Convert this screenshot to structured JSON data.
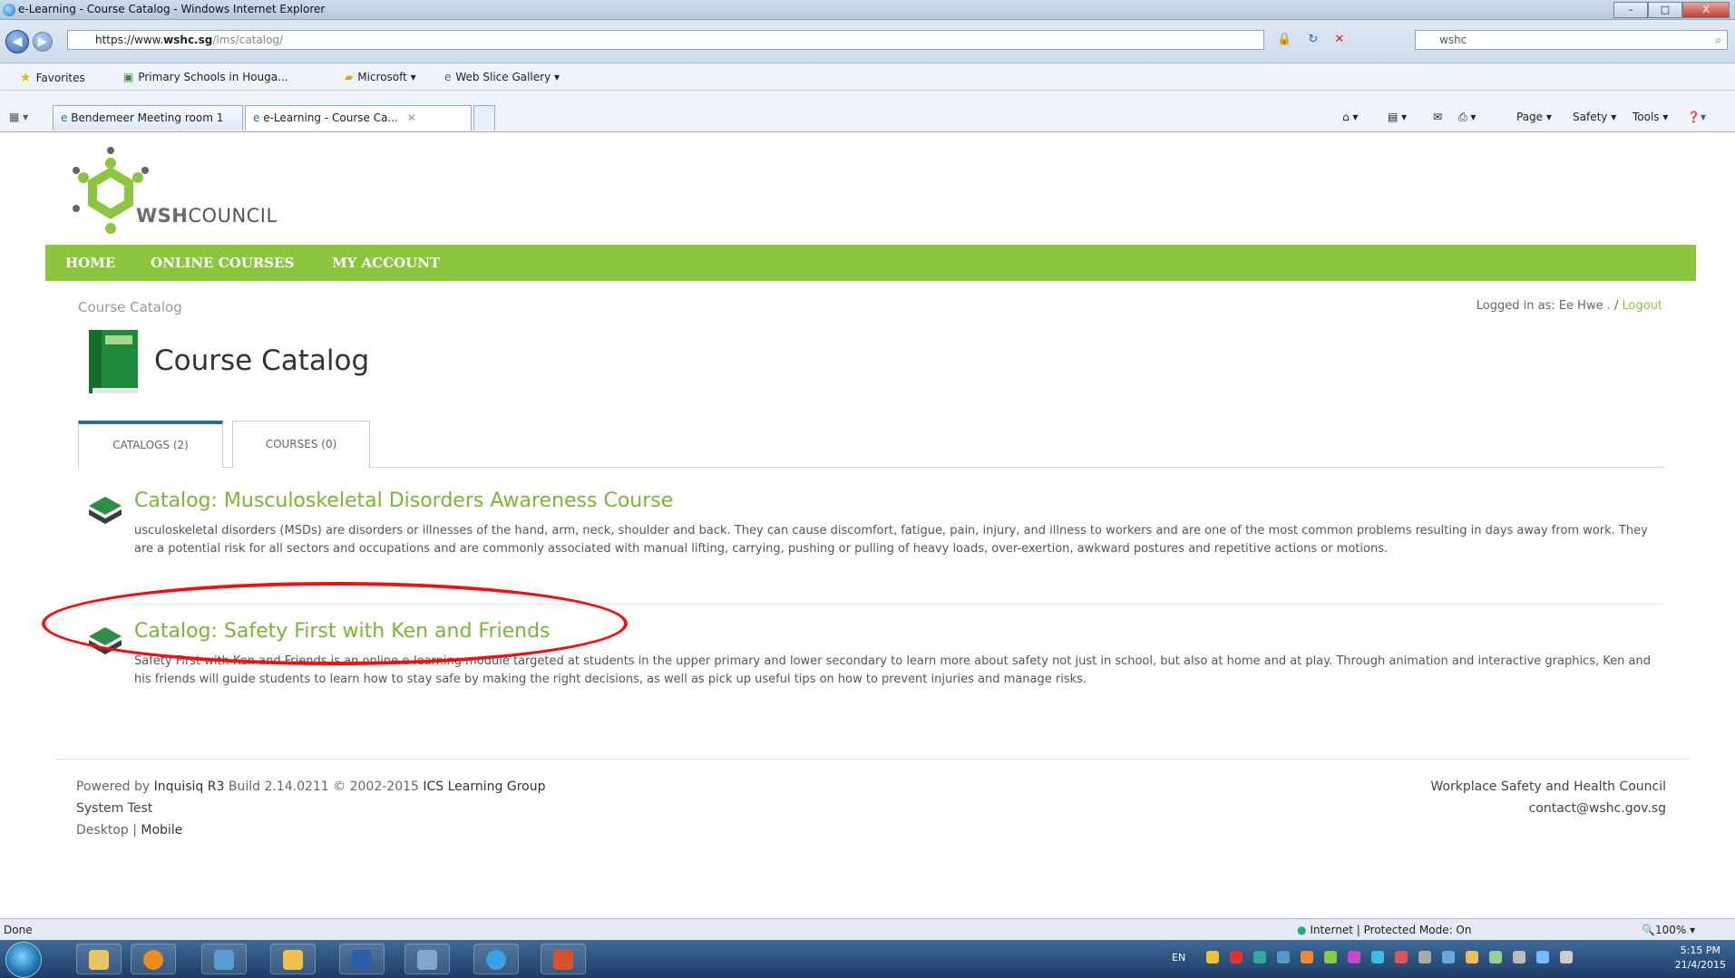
{
  "window": {
    "title": "e-Learning - Course Catalog - Windows Internet Explorer",
    "controls": [
      "–",
      "□",
      "X"
    ]
  },
  "browser": {
    "address_prefix": "https://www.",
    "address_domain": "wshc.sg",
    "address_path": "/lms/catalog/",
    "search_value": "wshc",
    "favorites_label": "Favorites",
    "favorites_items": [
      "Primary Schools in Houga...",
      "Microsoft ▾",
      "Web Slice Gallery ▾"
    ],
    "tabs": [
      "Bendemeer Meeting room 1",
      "e-Learning - Course Ca..."
    ],
    "commands": [
      "Page ▾",
      "Safety ▾",
      "Tools ▾"
    ],
    "status_left": "Done",
    "status_zone": "Internet | Protected Mode: On",
    "zoom": "100%"
  },
  "site": {
    "logo_bold": "WSH",
    "logo_rest": "COUNCIL",
    "nav": [
      "HOME",
      "ONLINE COURSES",
      "MY ACCOUNT"
    ],
    "breadcrumb": "Course Catalog",
    "logged_in_prefix": "Logged in as: Ee Hwe . / ",
    "logout": "Logout",
    "page_title": "Course Catalog",
    "tabs": [
      {
        "label": "CATALOGS (2)",
        "active": true
      },
      {
        "label": "COURSES (0)",
        "active": false
      }
    ],
    "catalogs": [
      {
        "title": "Catalog: Musculoskeletal Disorders Awareness Course",
        "description": "usculoskeletal disorders (MSDs) are disorders or illnesses of the hand, arm, neck, shoulder and back. They can cause discomfort, fatigue, pain, injury, and illness to workers and are one of the most common problems resulting in days away from work. They are a potential risk for all sectors and occupations and are commonly associated with manual lifting, carrying, pushing or pulling of heavy loads, over-exertion, awkward postures and repetitive actions or motions."
      },
      {
        "title": "Catalog: Safety First with Ken and Friends",
        "description": "Safety First with Ken and Friends is an online e-learning module targeted at students in the upper primary and lower secondary to learn more about safety not just in school, but also at home and at play. Through animation and interactive graphics, Ken and his friends will guide students to learn how to stay safe by making the right decisions, as well as pick up useful tips on how to prevent injuries and manage risks."
      }
    ],
    "footer": {
      "powered_prefix": "Powered by ",
      "powered_product": "Inquisiq R3",
      "powered_build": " Build 2.14.0211 © 2002-2015 ",
      "powered_company": "ICS Learning Group",
      "system": "System Test",
      "desktop": "Desktop",
      "divider": " | ",
      "mobile": "Mobile",
      "org": "Workplace Safety and Health Council",
      "email": "contact@wshc.gov.sg"
    }
  },
  "taskbar": {
    "lang": "EN",
    "time": "5:15 PM",
    "date": "21/4/2015"
  },
  "colors": {
    "brand_green": "#8cc63f",
    "title_green": "#7ab533",
    "annotation_red": "#ee1111",
    "tab_accent": "#2f6f8a"
  }
}
